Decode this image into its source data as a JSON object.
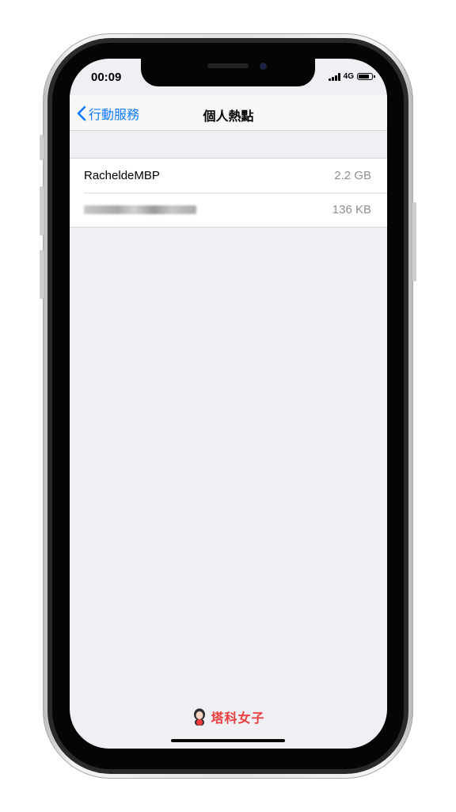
{
  "status_bar": {
    "time": "00:09",
    "network": "4G",
    "battery_level": 0.85
  },
  "nav": {
    "back_label": "行動服務",
    "title": "個人熱點"
  },
  "devices": [
    {
      "name": "RacheldeMBP",
      "usage": "2.2 GB",
      "name_blurred": false
    },
    {
      "name": "",
      "usage": "136 KB",
      "name_blurred": true
    }
  ],
  "watermark": {
    "text": "塔科女子",
    "color": "#f03c3c"
  },
  "colors": {
    "accent": "#0a7aff",
    "background": "#efeff4",
    "secondary_text": "#8e8e93"
  }
}
